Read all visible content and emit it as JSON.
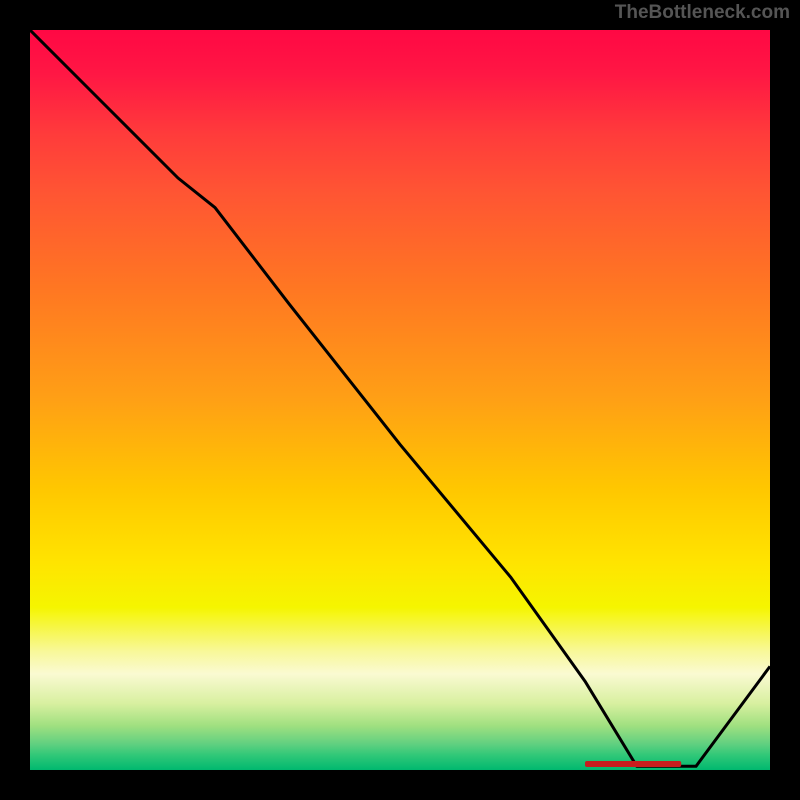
{
  "attribution": "TheBottleneck.com",
  "chart_data": {
    "type": "line",
    "title": "",
    "xlabel": "",
    "ylabel": "",
    "xlim": [
      0,
      100
    ],
    "ylim": [
      0,
      100
    ],
    "gradient_note": "background is a vertical heat gradient red->yellow->green; y-value encodes bottleneck % (top=high bottleneck/red, bottom=ideal/green)",
    "series": [
      {
        "name": "bottleneck-curve",
        "x": [
          0,
          10,
          20,
          25,
          35,
          50,
          65,
          75,
          82,
          90,
          100
        ],
        "y": [
          100,
          90,
          80,
          76,
          63,
          44,
          26,
          12,
          0.5,
          0.5,
          14
        ]
      }
    ],
    "optimal_region": {
      "x_start": 75,
      "x_end": 88,
      "label": ""
    },
    "optimal_label": ""
  }
}
